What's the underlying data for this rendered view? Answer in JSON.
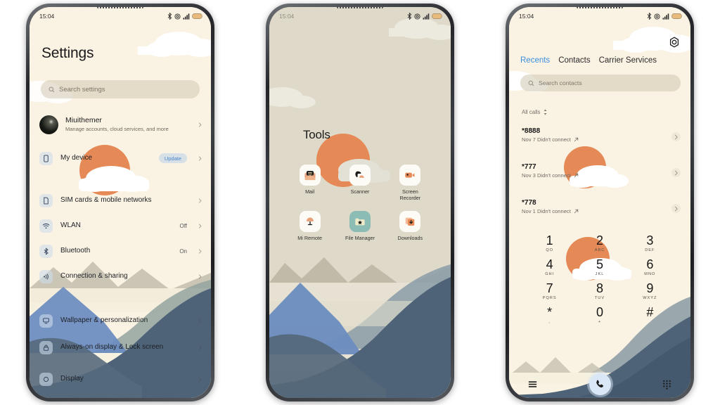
{
  "theme": {
    "cream": "#faf2e2",
    "beige": "#dfd9c9",
    "orange_sun": "#e58a56",
    "accent_blue": "#3b8ede",
    "mountain_dark": "#4e6377",
    "mountain_mid": "#8fa0a9",
    "mountain_blue": "#6a8cc0",
    "cloud_white": "#ffffff",
    "text_dark": "#1b1b1b"
  },
  "statusbar": {
    "time": "15:04",
    "icons": [
      "bluetooth-icon",
      "dnd-icon",
      "signal-icon",
      "battery-icon"
    ]
  },
  "settings": {
    "title": "Settings",
    "search": {
      "placeholder": "Search settings",
      "icon": "search-icon"
    },
    "account": {
      "name": "Miuithemer",
      "subtitle": "Manage accounts, cloud services, and more",
      "avatar": "avatar",
      "chevron": "chevron-right-icon"
    },
    "items": [
      {
        "label": "My device",
        "icon": "phone-icon",
        "value": "",
        "badge": "Update"
      },
      {
        "label": "SIM cards & mobile networks",
        "icon": "sim-icon",
        "value": "",
        "badge": ""
      },
      {
        "label": "WLAN",
        "icon": "wifi-icon",
        "value": "Off",
        "badge": ""
      },
      {
        "label": "Bluetooth",
        "icon": "bluetooth-icon",
        "value": "On",
        "badge": ""
      },
      {
        "label": "Connection & sharing",
        "icon": "sharing-icon",
        "value": "",
        "badge": ""
      },
      {
        "label": "Wallpaper & personalization",
        "icon": "wallpaper-icon",
        "value": "",
        "badge": ""
      },
      {
        "label": "Always-on display & Lock screen",
        "icon": "lock-icon",
        "value": "",
        "badge": ""
      },
      {
        "label": "Display",
        "icon": "display-icon",
        "value": "",
        "badge": ""
      }
    ]
  },
  "tools": {
    "title": "Tools",
    "apps": [
      {
        "label": "Mail",
        "icon": "mail-icon"
      },
      {
        "label": "Scanner",
        "icon": "scanner-icon"
      },
      {
        "label": "Screen Recorder",
        "icon": "screen-recorder-icon"
      },
      {
        "label": "Mi Remote",
        "icon": "mi-remote-icon"
      },
      {
        "label": "File Manager",
        "icon": "file-manager-icon"
      },
      {
        "label": "Downloads",
        "icon": "downloads-icon"
      }
    ]
  },
  "dialer": {
    "settings_icon": "gear-icon",
    "tabs": [
      {
        "label": "Recents",
        "active": true
      },
      {
        "label": "Contacts",
        "active": false
      },
      {
        "label": "Carrier Services",
        "active": false
      }
    ],
    "search": {
      "placeholder": "Search contacts",
      "icon": "search-icon"
    },
    "filter": {
      "label": "All calls",
      "icon": "sort-icon"
    },
    "calls": [
      {
        "number": "*8888",
        "meta": "Nov 7 Didn't connect",
        "arrow": "outgoing-arrow-icon"
      },
      {
        "number": "*777",
        "meta": "Nov 3 Didn't connect",
        "arrow": "outgoing-arrow-icon"
      },
      {
        "number": "*778",
        "meta": "Nov 1 Didn't connect",
        "arrow": "outgoing-arrow-icon"
      }
    ],
    "keypad": [
      {
        "digit": "1",
        "sub": "QO"
      },
      {
        "digit": "2",
        "sub": "ABC"
      },
      {
        "digit": "3",
        "sub": "DEF"
      },
      {
        "digit": "4",
        "sub": "GHI"
      },
      {
        "digit": "5",
        "sub": "JKL"
      },
      {
        "digit": "6",
        "sub": "MNO"
      },
      {
        "digit": "7",
        "sub": "PQRS"
      },
      {
        "digit": "8",
        "sub": "TUV"
      },
      {
        "digit": "9",
        "sub": "WXYZ"
      },
      {
        "digit": "*",
        "sub": ","
      },
      {
        "digit": "0",
        "sub": "+"
      },
      {
        "digit": "#",
        "sub": ""
      }
    ],
    "navbar": {
      "menu": "menu-icon",
      "call": "call-icon",
      "keypad": "keypad-icon"
    }
  }
}
